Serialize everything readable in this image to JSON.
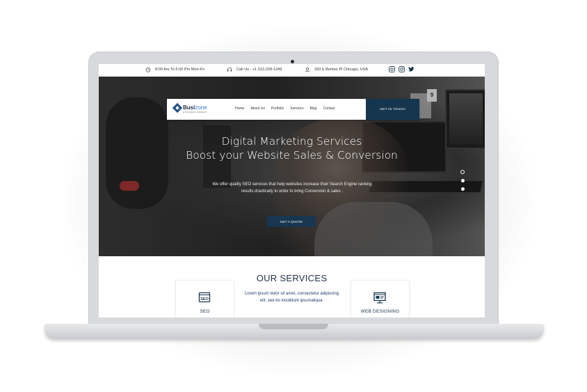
{
  "topbar": {
    "hours": "8:00 Am To 6:00 Pm Mon-Fri",
    "call": "Call Us : +1 312-228-1349",
    "address": "333 E Benton Pl Chicago, USA",
    "social_icons": [
      "instagram-icon",
      "instagram-icon",
      "twitter-icon"
    ]
  },
  "navbar": {
    "logo_bold": "Busi",
    "logo_light": "zone",
    "logo_tagline": "A BUSINESS COMPANY",
    "links": [
      "Home",
      "About Us",
      "Portfolio",
      "Services",
      "Blog",
      "Contact"
    ],
    "cta": "GET IN TOUCH"
  },
  "hero": {
    "title_line1": "Digital Marketing Services",
    "title_line2": "Boost your Website Sales & Conversion",
    "description": "We offer quality SEO services that help websites increase their Search Engine ranking results drastically in order to bring Conversion & sales .",
    "button": "GET A QUOTE",
    "slides_total": 3,
    "active_slide": 1
  },
  "services": {
    "title": "OUR SERVICES",
    "description": "Lorem ipsum dolor sit amet, consectetur adipiscing elit, sed do incididunt ipsumaliqua.",
    "cards": [
      {
        "label": "SEO",
        "icon": "seo-icon"
      },
      {
        "label": "WEB DESIGNING",
        "icon": "web-design-icon"
      }
    ]
  },
  "colors": {
    "primary_dark": "#16364f",
    "accent_blue": "#2f7fd3",
    "title_navy": "#1f2f4a"
  }
}
